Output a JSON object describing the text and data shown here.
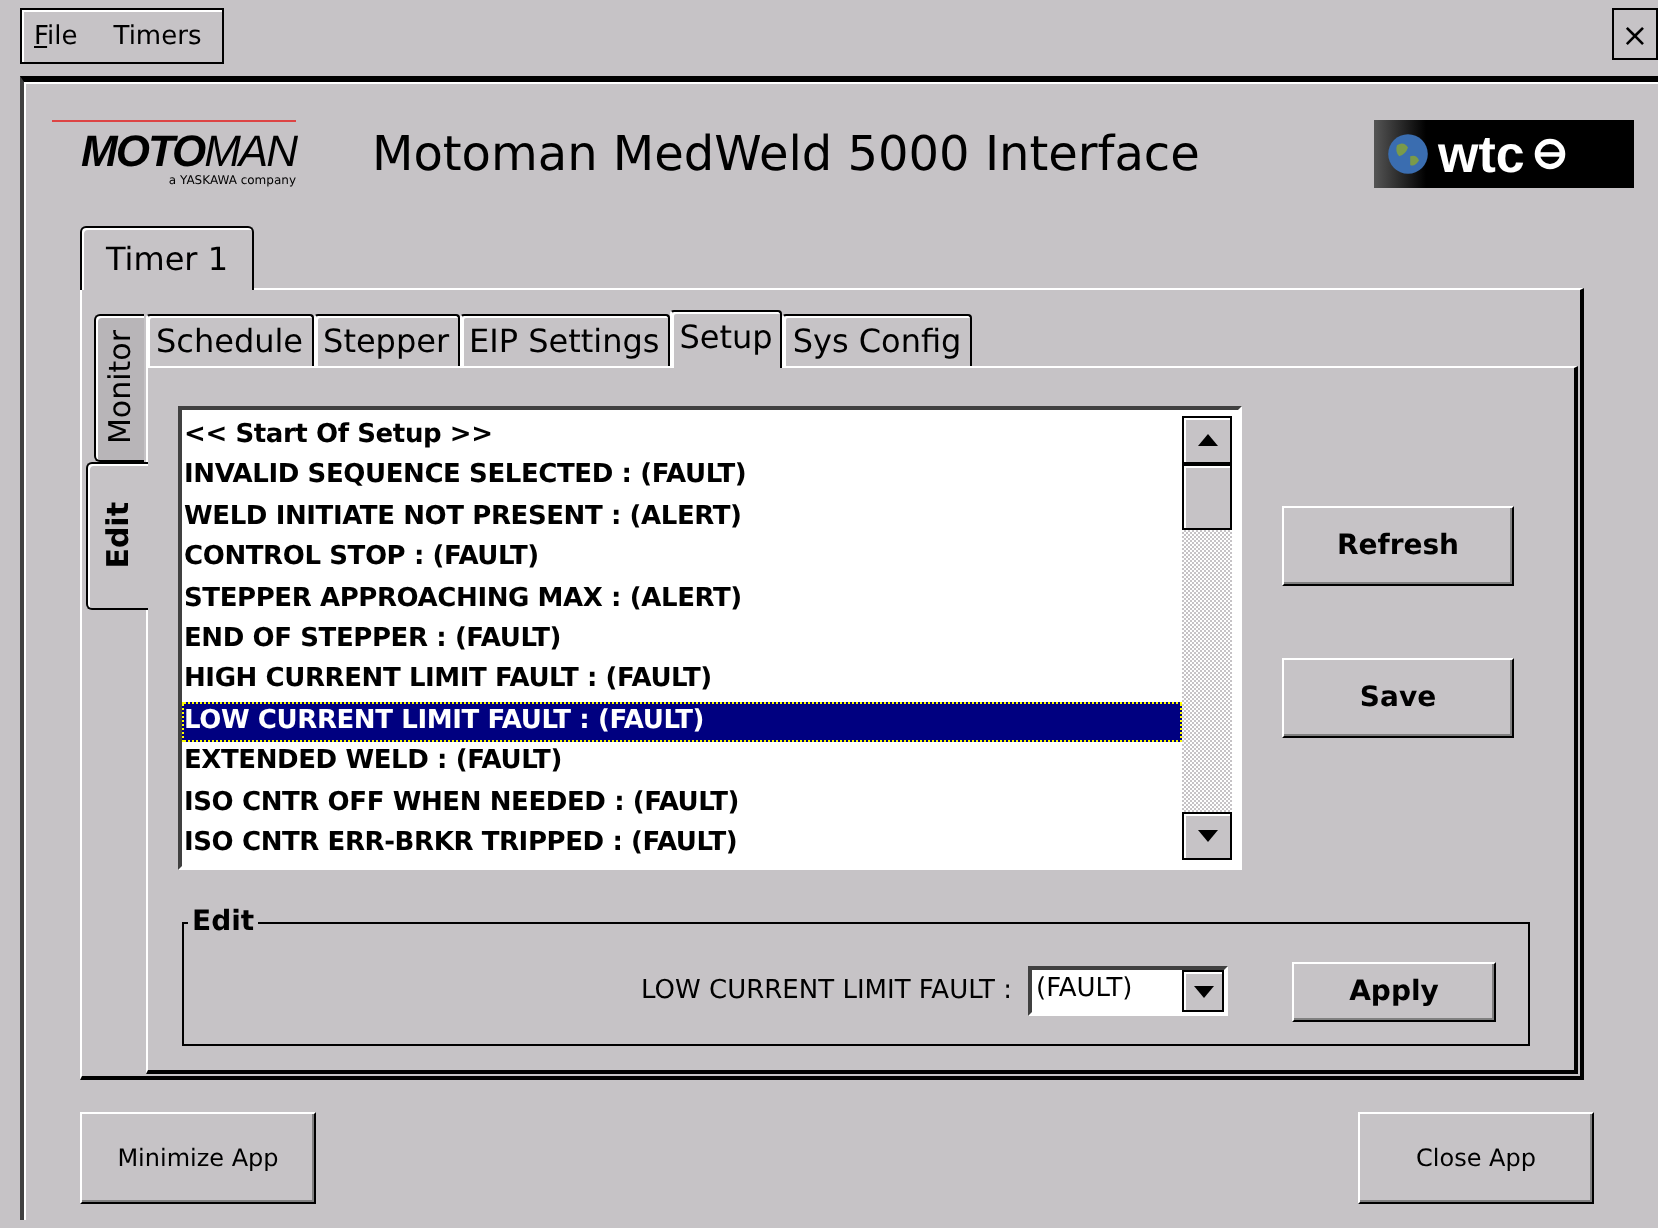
{
  "menu": [
    {
      "label": "File",
      "mnemonic": true
    },
    {
      "label": "Timers",
      "mnemonic": false
    }
  ],
  "close_button": "×",
  "header": {
    "logo": "**MOTO**MAN",
    "logo_tagline": "a YASKAWA company",
    "title": "Motoman MedWeld 5000 Interface",
    "brand_logo": "wtc"
  },
  "timer_tabs": [
    {
      "label": "Timer 1",
      "selected": true
    }
  ],
  "side_tabs": [
    {
      "label": "Monitor",
      "selected": false
    },
    {
      "label": "Edit",
      "selected": true
    }
  ],
  "tabs": [
    {
      "label": "Schedule",
      "selected": false
    },
    {
      "label": "Stepper",
      "selected": false
    },
    {
      "label": "EIP Settings",
      "selected": false
    },
    {
      "label": "Setup",
      "selected": true
    },
    {
      "label": "Sys Config",
      "selected": false
    }
  ],
  "setup_list": [
    {
      "text": "<< Start Of Setup >>",
      "selected": false
    },
    {
      "text": "INVALID SEQUENCE SELECTED : (FAULT)",
      "selected": false
    },
    {
      "text": "WELD INITIATE NOT PRESENT : (ALERT)",
      "selected": false
    },
    {
      "text": "CONTROL STOP : (FAULT)",
      "selected": false
    },
    {
      "text": "STEPPER APPROACHING MAX : (ALERT)",
      "selected": false
    },
    {
      "text": "END OF STEPPER : (FAULT)",
      "selected": false
    },
    {
      "text": "HIGH CURRENT LIMIT FAULT : (FAULT)",
      "selected": false
    },
    {
      "text": "LOW CURRENT LIMIT FAULT : (FAULT)",
      "selected": true
    },
    {
      "text": "EXTENDED WELD : (FAULT)",
      "selected": false
    },
    {
      "text": "ISO CNTR OFF WHEN NEEDED : (FAULT)",
      "selected": false
    },
    {
      "text": "ISO CNTR ERR-BRKR TRIPPED : (FAULT)",
      "selected": false
    }
  ],
  "side_buttons": [
    "Refresh",
    "Save"
  ],
  "edit_group": {
    "title": "Edit",
    "label": "LOW CURRENT LIMIT FAULT :",
    "value": "(FAULT)",
    "button": "Apply"
  },
  "footer_buttons": [
    "Minimize App",
    "Close App"
  ]
}
